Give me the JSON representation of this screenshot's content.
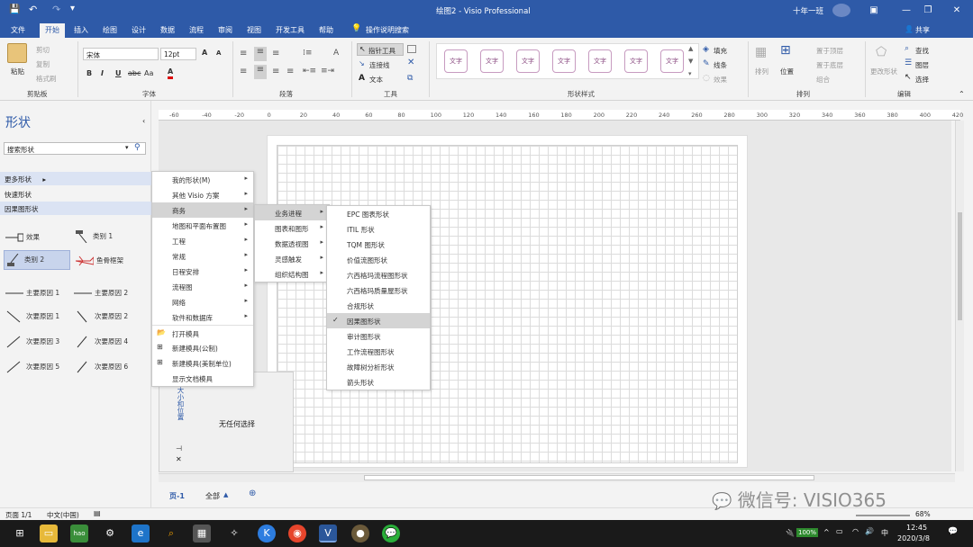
{
  "titlebar": {
    "doc_title": "绘图2 - Visio Professional",
    "user": "十年一班"
  },
  "ribbon_tabs": [
    "文件",
    "开始",
    "插入",
    "绘图",
    "设计",
    "数据",
    "流程",
    "审阅",
    "视图",
    "开发工具",
    "帮助"
  ],
  "active_tab": "开始",
  "tell_me": "操作说明搜索",
  "share": "共享",
  "clipboard": {
    "paste": "粘贴",
    "cut": "剪切",
    "copy": "复制",
    "format_painter": "格式刷",
    "label": "剪贴板"
  },
  "font": {
    "name": "宋体",
    "size": "12pt",
    "grow": "A",
    "shrink": "A",
    "label": "字体",
    "aa": "Aa",
    "bold": "B",
    "italic": "I",
    "underline": "U",
    "strike": "abc"
  },
  "paragraph": {
    "label": "段落"
  },
  "tools": {
    "pointer": "指针工具",
    "connector": "连接线",
    "text": "文本",
    "label": "工具"
  },
  "shape_styles": {
    "swatch_text": "文字",
    "label": "形状样式"
  },
  "fill": {
    "fill": "填充",
    "line": "线条",
    "effects": "效果"
  },
  "arrange": {
    "arrange": "排列",
    "position": "位置",
    "bring_front": "置于顶层",
    "send_back": "置于底层",
    "group": "组合",
    "label": "排列"
  },
  "editing": {
    "change_shape": "更改形状",
    "find": "查找",
    "layers": "图层",
    "select": "选择",
    "label": "编辑"
  },
  "shapes_pane": {
    "title": "形状",
    "search_placeholder": "搜索形状",
    "more_shapes": "更多形状",
    "quick_shapes": "快速形状",
    "stencil": "因果图形状"
  },
  "stencil_items": [
    {
      "label": "效果"
    },
    {
      "label": "类别 1"
    },
    {
      "label": "类别 2"
    },
    {
      "label": "鱼骨框架"
    },
    {
      "label": "主要原因 1"
    },
    {
      "label": "主要原因 2"
    },
    {
      "label": "次要原因 1"
    },
    {
      "label": "次要原因 2"
    },
    {
      "label": "次要原因 3"
    },
    {
      "label": "次要原因 4"
    },
    {
      "label": "次要原因 5"
    },
    {
      "label": "次要原因 6"
    }
  ],
  "ruler_top": [
    "-60",
    "-40",
    "-20",
    "0",
    "20",
    "40",
    "60",
    "80",
    "100",
    "120",
    "140",
    "160",
    "180",
    "200",
    "220",
    "240",
    "260",
    "280",
    "300",
    "320",
    "340",
    "360",
    "380",
    "400",
    "420"
  ],
  "ruler_left": [
    "220",
    "200",
    "40",
    "20"
  ],
  "menu1": [
    {
      "label": "我的形状(M)",
      "sub": true
    },
    {
      "label": "其他 Visio 方案",
      "sub": true
    },
    {
      "label": "商务",
      "sub": true,
      "hl": true
    },
    {
      "label": "地图和平面布置图",
      "sub": true
    },
    {
      "label": "工程",
      "sub": true
    },
    {
      "label": "常规",
      "sub": true
    },
    {
      "label": "日程安排",
      "sub": true
    },
    {
      "label": "流程图",
      "sub": true
    },
    {
      "label": "网络",
      "sub": true
    },
    {
      "label": "软件和数据库",
      "sub": true
    },
    {
      "label": "打开模具",
      "icon": "📂"
    },
    {
      "label": "新建模具(公制)",
      "icon": "⊞"
    },
    {
      "label": "新建模具(美制单位)",
      "icon": "⊞"
    },
    {
      "label": "显示文档模具"
    }
  ],
  "menu2": [
    {
      "label": "业务进程",
      "hl": true
    },
    {
      "label": "图表和图形"
    },
    {
      "label": "数据透视图"
    },
    {
      "label": "灵感触发"
    },
    {
      "label": "组织结构图"
    }
  ],
  "menu3": [
    {
      "label": "EPC 图表形状"
    },
    {
      "label": "ITIL 形状"
    },
    {
      "label": "TQM 图形状"
    },
    {
      "label": "价值流图形状"
    },
    {
      "label": "六西格玛流程图形状"
    },
    {
      "label": "六西格玛质量屋形状"
    },
    {
      "label": "合规形状"
    },
    {
      "label": "因果图形状",
      "hl": true,
      "checked": true
    },
    {
      "label": "审计图形状"
    },
    {
      "label": "工作流程图形状"
    },
    {
      "label": "故障树分析形状"
    },
    {
      "label": "箭头形状"
    }
  ],
  "sizepos": {
    "title": "大小和位置",
    "empty": "无任何选择"
  },
  "page_tabs": {
    "page": "页-1",
    "all": "全部"
  },
  "status": {
    "page": "页面 1/1",
    "lang": "中文(中国)",
    "zoom": "68%"
  },
  "watermark": "微信号: VISIO365",
  "clock": {
    "time": "12:45",
    "date": "2020/3/8"
  },
  "battery": "100%",
  "ime": "中",
  "colors": {
    "accent": "#2e5aa8"
  }
}
